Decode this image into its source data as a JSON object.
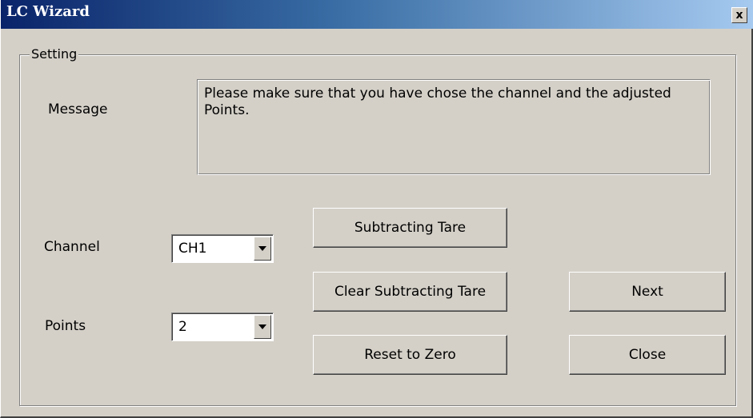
{
  "window": {
    "title": "LC Wizard",
    "close_symbol": "x"
  },
  "group": {
    "legend": "Setting"
  },
  "message": {
    "label": "Message",
    "text": "Please make sure that you have chose the channel and the adjusted Points."
  },
  "channel": {
    "label": "Channel",
    "selected": "CH1"
  },
  "points": {
    "label": "Points",
    "selected": "2"
  },
  "buttons": {
    "subtracting_tare": "Subtracting Tare",
    "clear_subtracting_tare": "Clear Subtracting Tare",
    "reset_to_zero": "Reset to Zero",
    "next": "Next",
    "close": "Close"
  },
  "colors": {
    "dialog_face": "#d4d0c8",
    "title_start": "#0a246a",
    "title_end": "#a6caf0"
  }
}
